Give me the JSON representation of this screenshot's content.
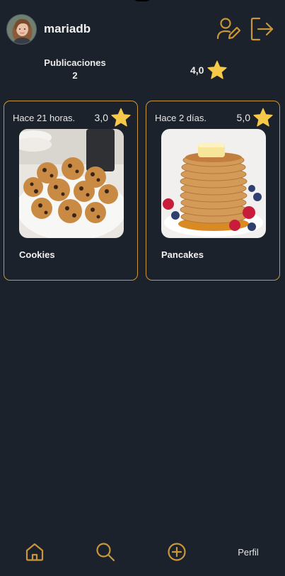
{
  "profile": {
    "username": "mariadb",
    "avatar_icon": "user-avatar",
    "actions": [
      {
        "name": "edit-profile-icon"
      },
      {
        "name": "logout-icon"
      }
    ]
  },
  "stats": {
    "publications_label": "Publicaciones",
    "publications_count": "2",
    "rating": "4,0"
  },
  "posts": [
    {
      "time": "Hace 21 horas.",
      "rating": "3,0",
      "title": "Cookies",
      "image": "cookies-photo"
    },
    {
      "time": "Hace 2 días.",
      "rating": "5,0",
      "title": "Pancakes",
      "image": "pancakes-photo"
    }
  ],
  "nav": {
    "items": [
      {
        "icon": "home-icon"
      },
      {
        "icon": "search-icon"
      },
      {
        "icon": "add-icon"
      },
      {
        "label": "Perfil"
      }
    ]
  },
  "colors": {
    "background": "#1b222b",
    "accent": "#c9973a",
    "star": "#f7c948"
  }
}
